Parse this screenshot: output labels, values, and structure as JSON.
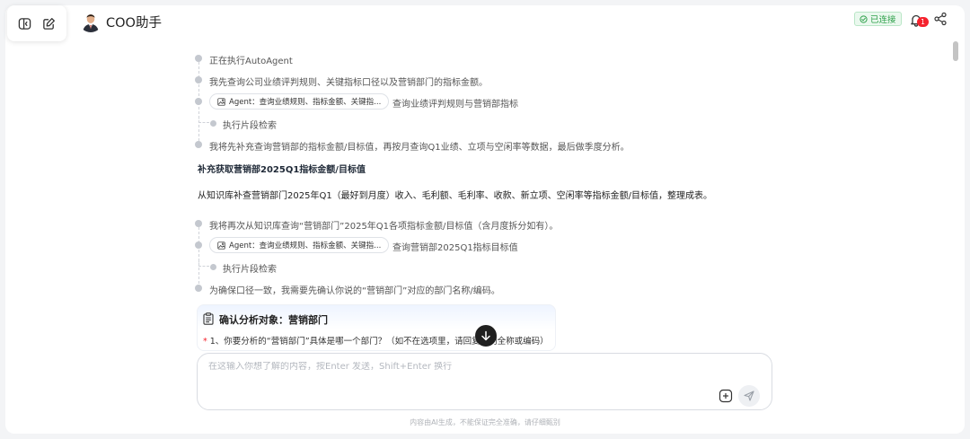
{
  "header": {
    "app_title": "COO助手",
    "status_label": "已连接",
    "notification_count": "1",
    "icons": [
      "sidebar-toggle-icon",
      "edit-icon",
      "check-circle-icon",
      "bell-icon",
      "share-icon"
    ]
  },
  "timeline": {
    "group1": {
      "step1": "正在执行AutoAgent",
      "step2": "我先查询公司业绩评判规则、关键指标口径以及营销部门的指标金额。",
      "agent_chip": "Agent：查询业绩规则、指标金额、关键指...",
      "agent_desc": "查询业绩评判规则与营销部指标",
      "sub_step": "执行片段检索",
      "step3": "我将先补充查询营销部的指标金额/目标值，再按月查询Q1业绩、立项与空闲率等数据，最后做季度分析。"
    },
    "section_heading": "补充获取营销部2025Q1指标金额/目标值",
    "section_paragraph": "从知识库补查营销部门2025年Q1（最好到月度）收入、毛利额、毛利率、收款、新立项、空闲率等指标金额/目标值，整理成表。",
    "group2": {
      "step1": "我将再次从知识库查询“营销部门”2025年Q1各项指标金额/目标值（含月度拆分如有）。",
      "agent_chip": "Agent：查询业绩规则、指标金额、关键指...",
      "agent_desc": "查询营销部2025Q1指标目标值",
      "sub_step": "执行片段检索",
      "step2": "为确保口径一致，我需要先确认你说的“营销部门”对应的部门名称/编码。"
    }
  },
  "confirm_card": {
    "title": "确认分析对象：营销部门",
    "required_mark": "*",
    "question": "1、你要分析的“营销部门”具体是哪一个部门？（如不在选项里，请回复部门全称或编码）"
  },
  "composer": {
    "placeholder": "在这输入你想了解的内容，按Enter 发送，Shift+Enter 换行",
    "value": ""
  },
  "footer": {
    "disclaimer": "内容由AI生成，不能保证完全准确，请仔细甄别"
  },
  "colors": {
    "accent_green": "#2ea04a",
    "badge_red": "#f5222d",
    "timeline_dot": "#c4c8cf"
  }
}
